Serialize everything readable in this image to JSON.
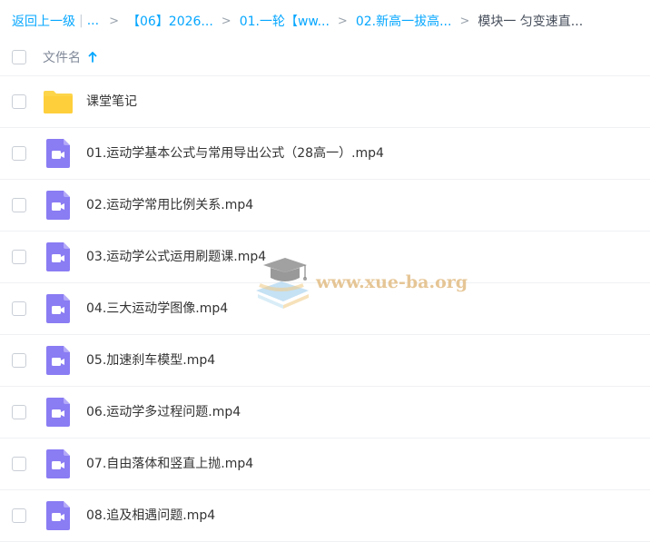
{
  "breadcrumb": {
    "back": "返回上一级",
    "ellipsis": "...",
    "items": [
      "【06】2026...",
      "01.一轮【ww...",
      "02.新高一拔高..."
    ],
    "current": "模块一 匀变速直..."
  },
  "header": {
    "column_title": "文件名"
  },
  "files": [
    {
      "name": "课堂笔记",
      "type": "folder"
    },
    {
      "name": "01.运动学基本公式与常用导出公式（28高一）.mp4",
      "type": "video"
    },
    {
      "name": "02.运动学常用比例关系.mp4",
      "type": "video"
    },
    {
      "name": "03.运动学公式运用刷题课.mp4",
      "type": "video"
    },
    {
      "name": "04.三大运动学图像.mp4",
      "type": "video"
    },
    {
      "name": "05.加速刹车模型.mp4",
      "type": "video"
    },
    {
      "name": "06.运动学多过程问题.mp4",
      "type": "video"
    },
    {
      "name": "07.自由落体和竖直上抛.mp4",
      "type": "video"
    },
    {
      "name": "08.追及相遇问题.mp4",
      "type": "video"
    }
  ],
  "watermark": {
    "text": "www.xue-ba.org"
  },
  "colors": {
    "link": "#06a7ff",
    "folder": "#fdd54a",
    "video": "#8a7cf3"
  },
  "icons": {
    "folder": "folder-icon",
    "video": "video-file-icon",
    "sort": "sort-ascending-arrow-icon"
  }
}
